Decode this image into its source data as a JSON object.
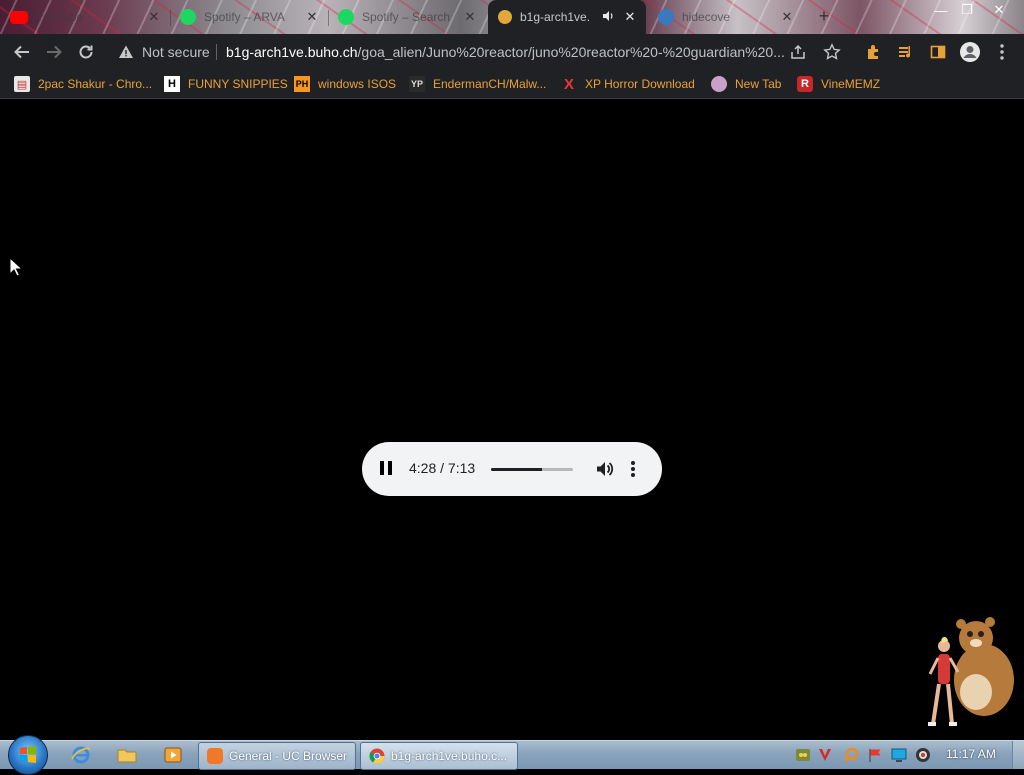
{
  "tabs": [
    {
      "title": "YouTube",
      "icon": "youtube-icon",
      "active": false
    },
    {
      "title": "Spotify – ARVA",
      "icon": "spotify-icon",
      "active": false
    },
    {
      "title": "Spotify – Search",
      "icon": "spotify-icon",
      "active": false
    },
    {
      "title": "b1g-arch1ve.",
      "icon": "site-favicon-icon",
      "active": true,
      "audio": true
    },
    {
      "title": "hidecove",
      "icon": "globe-icon",
      "active": false
    }
  ],
  "toolbar": {
    "security_label": "Not secure",
    "url_host": "b1g-arch1ve.buho.ch",
    "url_path": "/goa_alien/Juno%20reactor/juno%20reactor%20-%20guardian%20..."
  },
  "bookmarks": [
    {
      "label": "2pac Shakur - Chro...",
      "icon": "bookmark-favicon-icon"
    },
    {
      "label": "FUNNY SNIPPIES",
      "icon": "h-favicon-icon"
    },
    {
      "label": "windows ISOS",
      "icon": "ph-favicon-icon"
    },
    {
      "label": "EndermanCH/Malw...",
      "icon": "yp-favicon-icon"
    },
    {
      "label": "XP Horror Download",
      "icon": "x-favicon-icon"
    },
    {
      "label": "New Tab",
      "icon": "newtab-favicon-icon"
    },
    {
      "label": "VineMEMZ",
      "icon": "r-favicon-icon"
    }
  ],
  "player": {
    "time_display": "4:28 / 7:13",
    "progress": 0.62
  },
  "taskbar": {
    "tasks": [
      {
        "label": "General - UC Browser"
      },
      {
        "label": "b1g-arch1ve.buho.c..."
      }
    ],
    "clock": "11:17 AM"
  },
  "colors": {
    "browser_bg": "#202124",
    "bookmark_text": "#e8a13a",
    "player_bg": "#f1f3f4",
    "page_bg": "#000000"
  }
}
